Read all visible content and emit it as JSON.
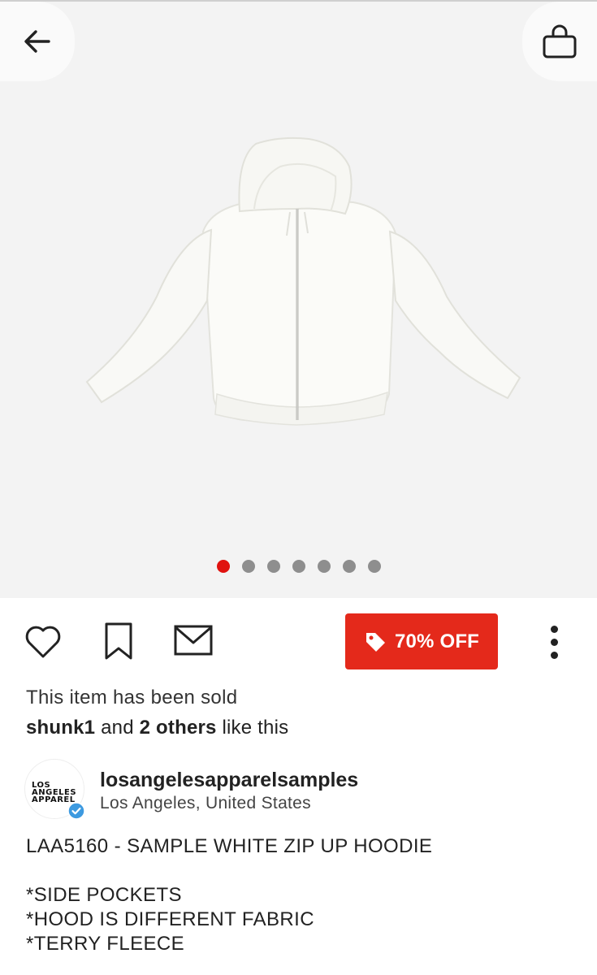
{
  "product": {
    "image_alt": "white zip up hoodie",
    "carousel": {
      "total": 7,
      "active_index": 0
    }
  },
  "actions": {
    "discount_label": "70% OFF"
  },
  "status": {
    "sold_text": "This item has been sold",
    "likes": {
      "user": "shunk1",
      "connector": "and",
      "others": "2 others",
      "suffix": "like this"
    }
  },
  "seller": {
    "logo_lines": [
      "LOS",
      "ANGELES",
      "APPAREL"
    ],
    "username": "losangelesapparelsamples",
    "location": "Los Angeles, United States"
  },
  "description": {
    "lines": [
      "LAA5160 - SAMPLE WHITE ZIP UP HOODIE",
      "",
      "*SIDE POCKETS",
      "*HOOD IS DIFFERENT FABRIC",
      "*TERRY FLEECE"
    ]
  },
  "colors": {
    "accent_red": "#e4291b",
    "active_dot": "#e0120f",
    "verified_blue": "#3d9ae0"
  },
  "icons": [
    "back-arrow-icon",
    "shopping-bag-icon",
    "heart-icon",
    "bookmark-icon",
    "envelope-icon",
    "price-tag-icon",
    "more-vertical-icon",
    "verified-badge-icon"
  ]
}
